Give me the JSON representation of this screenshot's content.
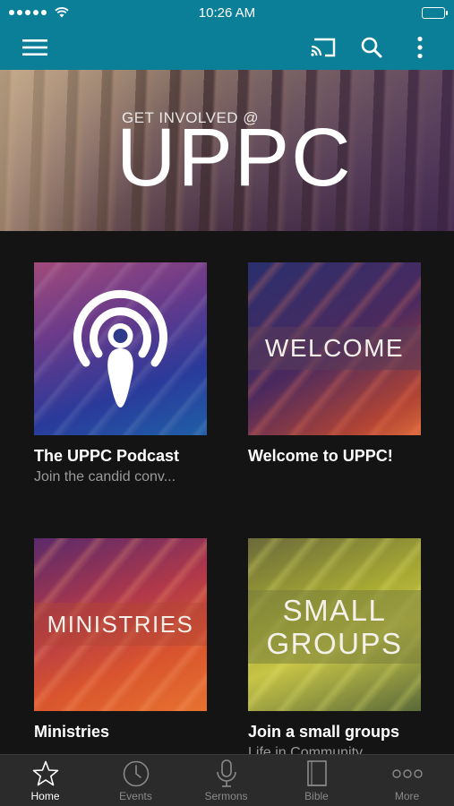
{
  "status_bar": {
    "time": "10:26 AM"
  },
  "toolbar": {
    "icons": [
      "menu-icon",
      "cast-icon",
      "search-icon",
      "more-vertical-icon"
    ]
  },
  "hero": {
    "subtitle": "GET INVOLVED @",
    "title": "UPPC"
  },
  "cards": [
    {
      "title": "The UPPC Podcast",
      "subtitle": "Join the candid conv..."
    },
    {
      "title": "Welcome to UPPC!",
      "subtitle": "",
      "thumb_text": "WELCOME"
    },
    {
      "title": "Ministries",
      "subtitle": "",
      "thumb_text": "MINISTRIES"
    },
    {
      "title": "Join a small groups",
      "subtitle": "Life in Community",
      "thumb_text_line1": "SMALL",
      "thumb_text_line2": "GROUPS"
    }
  ],
  "tabs": [
    {
      "label": "Home",
      "icon": "star-icon",
      "active": true
    },
    {
      "label": "Events",
      "icon": "clock-icon"
    },
    {
      "label": "Sermons",
      "icon": "microphone-icon"
    },
    {
      "label": "Bible",
      "icon": "book-icon"
    },
    {
      "label": "More",
      "icon": "more-horizontal-icon"
    }
  ],
  "colors": {
    "app_bar": "#0b7f97",
    "background": "#141414",
    "tab_bar": "#2b2b2b"
  }
}
